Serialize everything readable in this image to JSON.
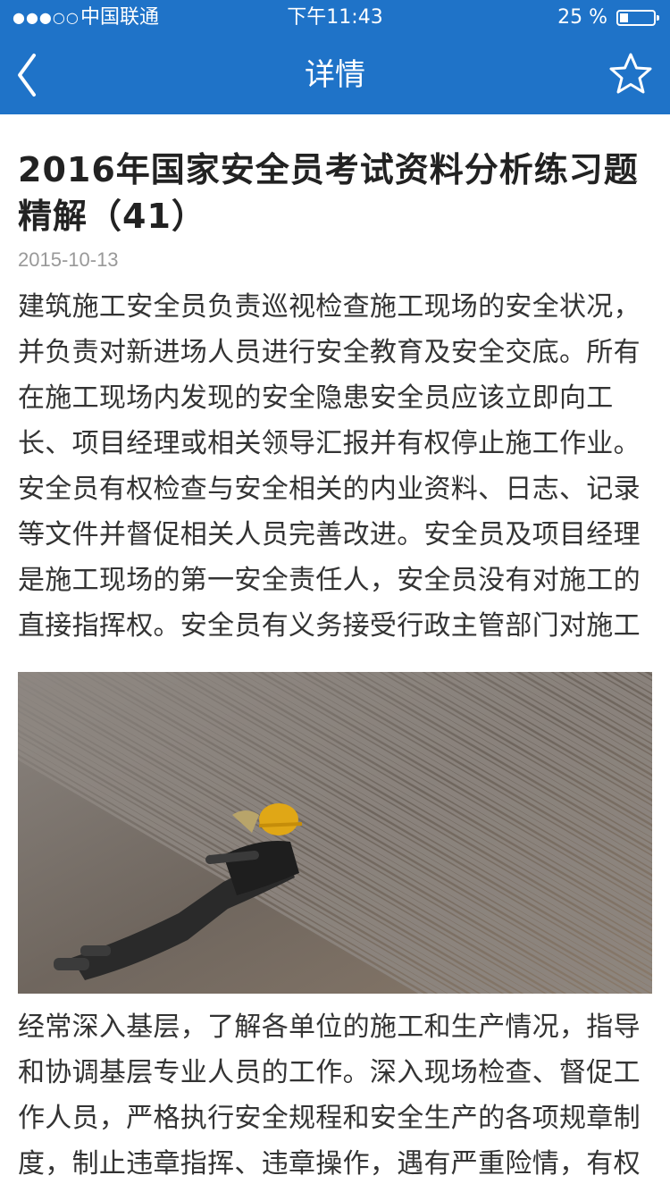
{
  "status_bar": {
    "signal": "●●●○○",
    "carrier": "中国联通",
    "time": "下午11:43",
    "battery": "25 %"
  },
  "nav": {
    "title": "详情",
    "back_icon": "chevron-left-icon",
    "favorite_icon": "star-outline-icon"
  },
  "article": {
    "title": "2016年国家安全员考试资料分析练习题精解（41）",
    "date": "2015-10-13",
    "paragraph_1": "建筑施工安全员负责巡视检查施工现场的安全状况，并负责对新进场人员进行安全教育及安全交底。所有在施工现场内发现的安全隐患安全员应该立即向工长、项目经理或相关领导汇报并有权停止施工作业。安全员有权检查与安全相关的内业资料、日志、记录等文件并督促相关人员完善改进。安全员及项目经理是施工现场的第一安全责任人，安全员没有对施工的直接指挥权。安全员有义务接受行政主管部门对施工",
    "paragraph_2": "经常深入基层，了解各单位的施工和生产情况，指导和协调基层专业人员的工作。深入现场检查、督促工作人员，严格执行安全规程和安全生产的各项规章制度，制止违章指挥、违章操作，遇有严重险情，有权"
  },
  "colors": {
    "accent": "#1f73c8",
    "title_text": "#222222",
    "body_text": "#333333",
    "date_text": "#999999"
  }
}
